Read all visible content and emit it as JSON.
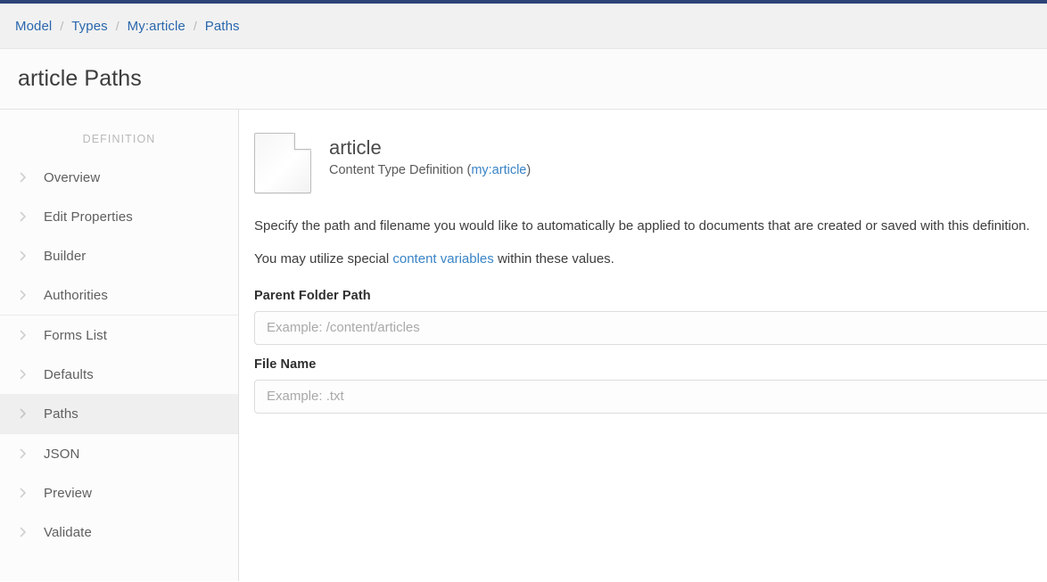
{
  "theme": {
    "accent_bar": "#2c4377",
    "link_blue": "#2a67ad",
    "content_link_blue": "#3a84c6",
    "selected_item_bg": "#efefef"
  },
  "breadcrumb": {
    "separator": "/",
    "items": [
      {
        "label": "Model"
      },
      {
        "label": "Types"
      },
      {
        "label": "My:article"
      },
      {
        "label": "Paths"
      }
    ]
  },
  "header": {
    "page_title": "article Paths"
  },
  "sidebar": {
    "heading": "DEFINITION",
    "groups": [
      {
        "items": [
          {
            "label": "Overview",
            "icon": "chevron-right-icon",
            "selected": false
          },
          {
            "label": "Edit Properties",
            "icon": "chevron-right-icon",
            "selected": false
          },
          {
            "label": "Builder",
            "icon": "chevron-right-icon",
            "selected": false
          },
          {
            "label": "Authorities",
            "icon": "chevron-right-icon",
            "selected": false
          }
        ]
      },
      {
        "items": [
          {
            "label": "Forms List",
            "icon": "chevron-right-icon",
            "selected": false
          },
          {
            "label": "Defaults",
            "icon": "chevron-right-icon",
            "selected": false
          },
          {
            "label": "Paths",
            "icon": "chevron-right-icon",
            "selected": true
          }
        ]
      },
      {
        "items": [
          {
            "label": "JSON",
            "icon": "chevron-right-icon",
            "selected": false
          },
          {
            "label": "Preview",
            "icon": "chevron-right-icon",
            "selected": false
          },
          {
            "label": "Validate",
            "icon": "chevron-right-icon",
            "selected": false
          }
        ]
      }
    ]
  },
  "main": {
    "doc": {
      "icon": "document-page-icon",
      "name": "article",
      "subtitle_prefix": "Content Type Definition (",
      "subtitle_link": "my:article",
      "subtitle_suffix": ")"
    },
    "intro_1": "Specify the path and filename you would like to automatically be applied to documents that are created or saved with this definition.",
    "intro_2_prefix": "You may utilize special ",
    "intro_2_link": "content variables",
    "intro_2_suffix": " within these values.",
    "fields": [
      {
        "label": "Parent Folder Path",
        "placeholder": "Example: /content/articles",
        "value": ""
      },
      {
        "label": "File Name",
        "placeholder": "Example: .txt",
        "value": ""
      }
    ]
  }
}
